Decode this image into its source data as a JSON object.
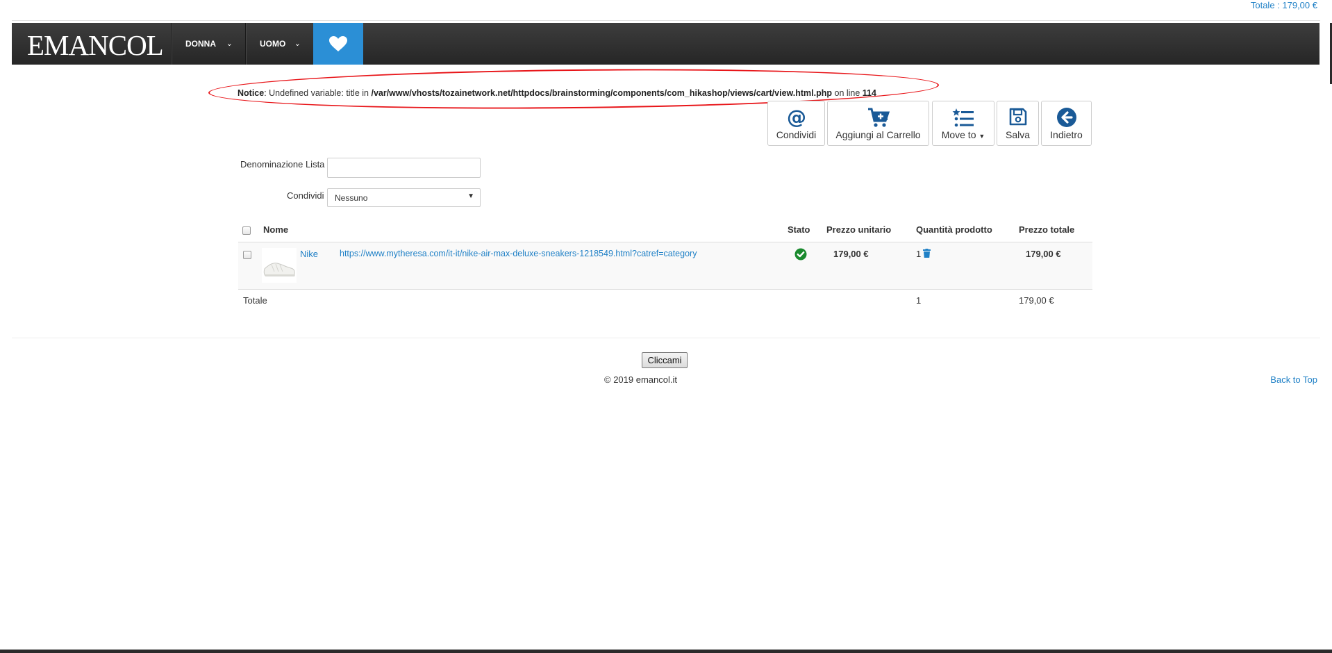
{
  "header": {
    "cart_total": "Totale : 179,00 €",
    "logo": "EMANCOL",
    "nav": [
      {
        "label": "DONNA",
        "chevron": "⌄"
      },
      {
        "label": "UOMO",
        "chevron": "⌄"
      }
    ],
    "wishlist_icon": "heart-icon"
  },
  "notice": {
    "label": "Notice",
    "message": ": Undefined variable: title in ",
    "path": "/var/www/vhosts/tozainetwork.net/httpdocs/brainstorming/components/com_hikashop/views/cart/view.html.php",
    "online": " on line ",
    "line": "114",
    "annotation_color": "#e8161a"
  },
  "toolbar": {
    "share": "Condividi",
    "add_to_cart": "Aggiungi al Carrello",
    "move_to": "Move to",
    "save": "Salva",
    "back": "Indietro",
    "icon_color": "#1a5a97"
  },
  "form": {
    "list_name_label": "Denominazione Lista",
    "list_name_value": "",
    "share_label": "Condividi",
    "share_value": "Nessuno"
  },
  "table": {
    "headers": {
      "name": "Nome",
      "status": "Stato",
      "unit_price": "Prezzo unitario",
      "quantity": "Quantità prodotto",
      "total_price": "Prezzo totale"
    },
    "rows": [
      {
        "name": "Nike",
        "url": "https://www.mytheresa.com/it-it/nike-air-max-deluxe-sneakers-1218549.html?catref=category",
        "status_icon": "check-circle-icon",
        "unit_price": "179,00 €",
        "quantity": "1",
        "total_price": "179,00 €"
      }
    ],
    "totals": {
      "label": "Totale",
      "quantity": "1",
      "price": "179,00 €"
    }
  },
  "footer": {
    "button": "Cliccami",
    "copyright": "© 2019 emancol.it",
    "back_to_top": "Back to Top"
  },
  "colors": {
    "accent": "#1f80c6",
    "heart_tile": "#2b8fd6",
    "status_ok": "#1a8a2e"
  }
}
